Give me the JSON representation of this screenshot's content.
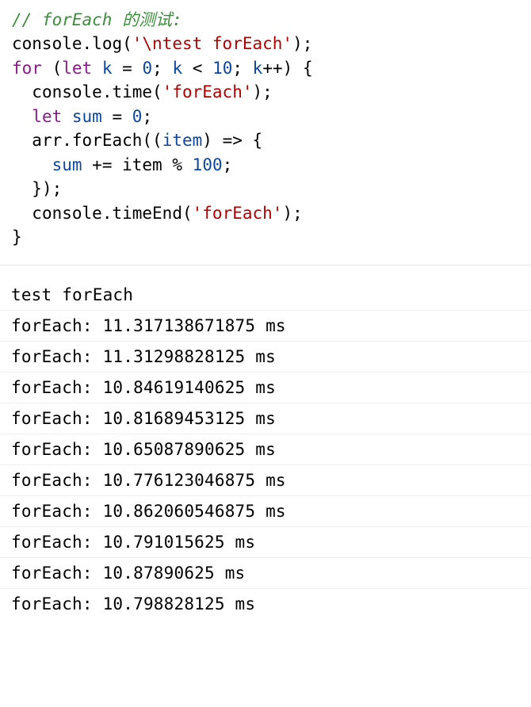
{
  "code": {
    "comment": "// forEach 的测试:",
    "log": "'\\ntest forEach'",
    "timeLabel": "'forEach'",
    "timeEndLabel": "'forEach'",
    "loopVar": "k",
    "loopStart": "0",
    "loopLimit": "10",
    "sumInit": "0",
    "sumVar": "sum",
    "modVal": "100",
    "arrName": "arr",
    "itemName": "item"
  },
  "console": {
    "header": "test forEach",
    "lines": [
      "forEach: 11.317138671875 ms",
      "forEach: 11.31298828125 ms",
      "forEach: 10.84619140625 ms",
      "forEach: 10.81689453125 ms",
      "forEach: 10.65087890625 ms",
      "forEach: 10.776123046875 ms",
      "forEach: 10.862060546875 ms",
      "forEach: 10.791015625 ms",
      "forEach: 10.87890625 ms",
      "forEach: 10.798828125 ms"
    ]
  }
}
